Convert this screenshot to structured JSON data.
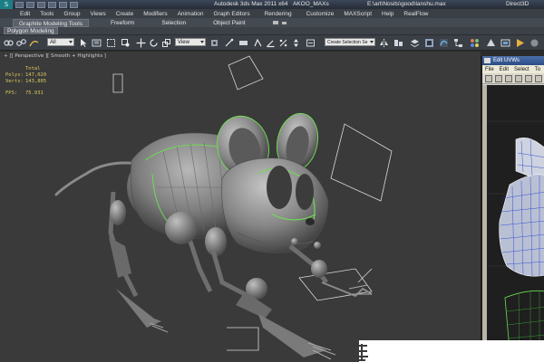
{
  "titlebar": {
    "title": "Autodesk 3ds Max  2011 x64",
    "project": "AKOO_MAXs",
    "file": "E:\\art\\Nosits\\good\\lanshu.max",
    "renderer": "Direct3D"
  },
  "menubar": {
    "items": [
      "Edit",
      "Tools",
      "Group",
      "Views",
      "Create",
      "Modifiers",
      "Animation",
      "Graph Editors",
      "Rendering",
      "Customize",
      "MAXScript",
      "Help",
      "RealFlow"
    ]
  },
  "ribbon": {
    "tabs": [
      "Graphite Modeling Tools",
      "Freeform",
      "Selection",
      "Object Paint"
    ],
    "active_tab": "Graphite Modeling Tools",
    "panel_label": "Polygon Modeling"
  },
  "toolbar": {
    "filter_value": "All",
    "coord_value": "View",
    "selection_set_placeholder": "Create Selection Se"
  },
  "viewport": {
    "label": "+ ][ Perspective ][ Smooth + Highlights ]",
    "stats": {
      "total_label": "Total",
      "polys_label": "Polys:",
      "polys_value": "147,020",
      "verts_label": "Verts:",
      "verts_value": "143,805",
      "fps_label": "FPS:",
      "fps_value": "75.931"
    },
    "wire_color": "#d8d8d8",
    "edge_color": "#6fdc52",
    "mesh_color": "#8a8a8a"
  },
  "uvw_window": {
    "title": "Edit UVWs",
    "menu": [
      "File",
      "Edit",
      "Select",
      "To"
    ]
  },
  "icons": {
    "app": "3ds-max-logo-icon",
    "toolbar": [
      "link-icon",
      "unlink-icon",
      "bind-space-warp-icon",
      "select-object-icon",
      "select-by-name-icon",
      "rect-region-icon",
      "window-crossing-icon",
      "move-icon",
      "rotate-icon",
      "scale-icon",
      "pivot-icon",
      "select-manipulate-icon",
      "keyboard-shortcut-icon",
      "snap-toggle-icon",
      "angle-snap-icon",
      "percent-snap-icon",
      "spinner-snap-icon",
      "named-selection-icon",
      "mirror-icon",
      "align-icon",
      "layer-manager-icon",
      "graphite-toggle-icon",
      "curve-editor-icon",
      "schematic-view-icon",
      "material-editor-icon",
      "render-setup-icon",
      "rendered-frame-icon",
      "render-icon"
    ]
  }
}
